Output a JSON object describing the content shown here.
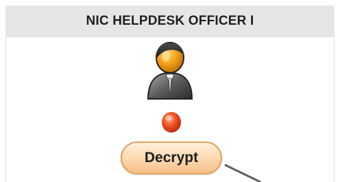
{
  "header": {
    "title": "NIC HELPDESK OFFICER I"
  },
  "avatar": {
    "icon": "user-avatar-icon"
  },
  "status": {
    "icon": "status-dot-icon",
    "color": "#e8431a"
  },
  "actions": {
    "decrypt_label": "Decrypt"
  },
  "colors": {
    "header_bg": "#e6e6e6",
    "button_border": "#e3a05a",
    "button_fill": "#fbd7ad"
  }
}
